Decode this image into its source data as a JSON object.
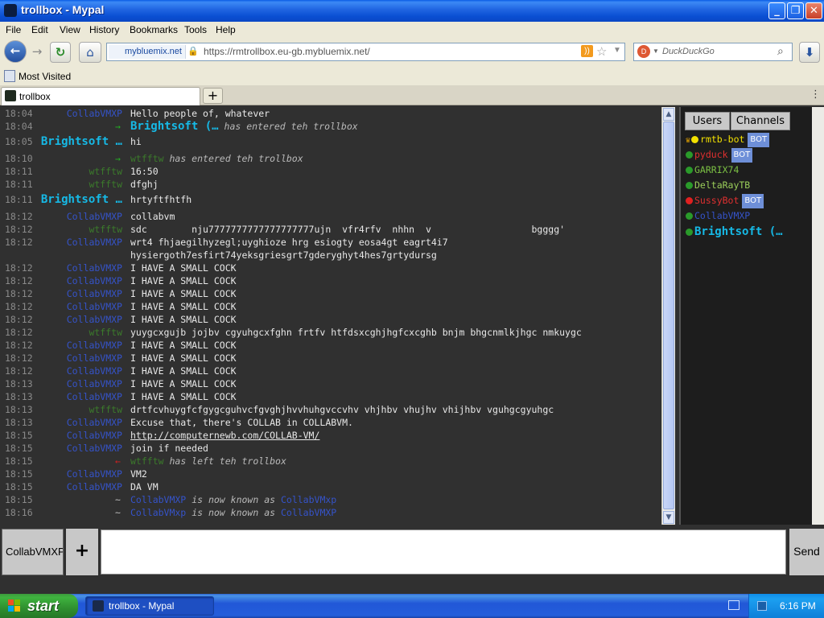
{
  "window": {
    "title": "trollbox - Mypal"
  },
  "menu": [
    "File",
    "Edit",
    "View",
    "History",
    "Bookmarks",
    "Tools",
    "Help"
  ],
  "navbar": {
    "identity": "mybluemix.net",
    "url": "https://rmtrollbox.eu-gb.mybluemix.net/",
    "search_placeholder": "DuckDuckGo"
  },
  "bookmarks": {
    "most_visited": "Most Visited"
  },
  "tabs": [
    {
      "label": "trollbox"
    }
  ],
  "chat": {
    "rows": [
      {
        "time": "18:04",
        "nick": "CollabVMXP",
        "nick_style": "blue",
        "msg": "Hello people of, whatever"
      },
      {
        "time": "18:04",
        "arrow": "→",
        "arrow_style": "green",
        "sys_nick": "Brightsoft (…",
        "sys_nick_style": "bright",
        "sys_text": "has entered teh trollbox"
      },
      {
        "time": "18:05",
        "nick": "Brightsoft …",
        "nick_style": "bright",
        "msg": "hi"
      },
      {
        "time": "18:10",
        "arrow": "→",
        "arrow_style": "green",
        "sys_nick": "wtfftw",
        "sys_nick_style": "green",
        "sys_text": "has entered teh trollbox"
      },
      {
        "time": "18:11",
        "nick": "wtfftw",
        "nick_style": "green",
        "msg": "16:50"
      },
      {
        "time": "18:11",
        "nick": "wtfftw",
        "nick_style": "green",
        "msg": "dfghj"
      },
      {
        "time": "18:11",
        "nick": "Brightsoft …",
        "nick_style": "bright",
        "msg": "hrtyftfhtfh"
      },
      {
        "time": "18:12",
        "nick": "CollabVMXP",
        "nick_style": "blue",
        "msg": "collabvm"
      },
      {
        "time": "18:12",
        "nick": "wtfftw",
        "nick_style": "green",
        "msg": "sdc        nju7777777777777777777ujn  vfr4rfv  nhhn  v                  bgggg'"
      },
      {
        "time": "18:12",
        "nick": "CollabVMXP",
        "nick_style": "blue",
        "msg": "wrt4 fhjaegilhyzegl;uyghioze hrg esiogty eosa4gt eagrt4i7"
      },
      {
        "time": "",
        "nick": "",
        "msg": "hysiergoth7esfirt74yeksgriesgrt7gderyghyt4hes7grtydursg"
      },
      {
        "time": "18:12",
        "nick": "CollabVMXP",
        "nick_style": "blue",
        "msg": "I HAVE A SMALL COCK"
      },
      {
        "time": "18:12",
        "nick": "CollabVMXP",
        "nick_style": "blue",
        "msg": "I HAVE A SMALL COCK"
      },
      {
        "time": "18:12",
        "nick": "CollabVMXP",
        "nick_style": "blue",
        "msg": "I HAVE A SMALL COCK"
      },
      {
        "time": "18:12",
        "nick": "CollabVMXP",
        "nick_style": "blue",
        "msg": "I HAVE A SMALL COCK"
      },
      {
        "time": "18:12",
        "nick": "CollabVMXP",
        "nick_style": "blue",
        "msg": "I HAVE A SMALL COCK"
      },
      {
        "time": "18:12",
        "nick": "wtfftw",
        "nick_style": "green",
        "msg": "yuygcxgujb jojbv cgyuhgcxfghn frtfv htfdsxcghjhgfcxcghb bnjm bhgcnmlkjhgc nmkuygc"
      },
      {
        "time": "18:12",
        "nick": "CollabVMXP",
        "nick_style": "blue",
        "msg": "I HAVE A SMALL COCK"
      },
      {
        "time": "18:12",
        "nick": "CollabVMXP",
        "nick_style": "blue",
        "msg": "I HAVE A SMALL COCK"
      },
      {
        "time": "18:12",
        "nick": "CollabVMXP",
        "nick_style": "blue",
        "msg": "I HAVE A SMALL COCK"
      },
      {
        "time": "18:13",
        "nick": "CollabVMXP",
        "nick_style": "blue",
        "msg": "I HAVE A SMALL COCK"
      },
      {
        "time": "18:13",
        "nick": "CollabVMXP",
        "nick_style": "blue",
        "msg": "I HAVE A SMALL COCK"
      },
      {
        "time": "18:13",
        "nick": "wtfftw",
        "nick_style": "green",
        "msg": "drtfcvhuygfcfgygcguhvcfgvghjhvvhuhgvccvhv vhjhbv vhujhv vhijhbv vguhgcgyuhgc"
      },
      {
        "time": "18:13",
        "nick": "CollabVMXP",
        "nick_style": "blue",
        "msg": "Excuse that, there's COLLAB in COLLABVM."
      },
      {
        "time": "18:15",
        "nick": "CollabVMXP",
        "nick_style": "blue",
        "msg": "http://computernewb.com/COLLAB-VM/",
        "link": true
      },
      {
        "time": "18:15",
        "nick": "CollabVMXP",
        "nick_style": "blue",
        "msg": "join if needed"
      },
      {
        "time": "18:15",
        "arrow": "←",
        "arrow_style": "red",
        "sys_nick": "wtfftw",
        "sys_nick_style": "green",
        "sys_text": "has left teh trollbox"
      },
      {
        "time": "18:15",
        "nick": "CollabVMXP",
        "nick_style": "blue",
        "msg": "VM2"
      },
      {
        "time": "18:15",
        "nick": "CollabVMXP",
        "nick_style": "blue",
        "msg": "DA VM"
      },
      {
        "time": "18:15",
        "arrow": "~",
        "arrow_style": "grey",
        "sys_nick": "CollabVMXP",
        "sys_nick_style": "blue",
        "sys_text": "is now known as",
        "sys_nick2": "CollabVMxp"
      },
      {
        "time": "18:16",
        "arrow": "~",
        "arrow_style": "grey",
        "sys_nick": "CollabVMxp",
        "sys_nick_style": "blue",
        "sys_text": "is now known as",
        "sys_nick2": "CollabVMXP"
      }
    ]
  },
  "panel": {
    "tabs": [
      "Users",
      "Channels"
    ],
    "users": [
      {
        "name": "rmtb-bot",
        "color": "#f2e000",
        "dot": "#f2e000",
        "crown": true,
        "badge": "BOT"
      },
      {
        "name": "pyduck",
        "color": "#e03030",
        "dot": "#2a9a2a",
        "badge": "BOT"
      },
      {
        "name": "GARRIX74",
        "color": "#7bc043",
        "dot": "#2a9a2a"
      },
      {
        "name": "DeltaRayTB",
        "color": "#9acd5a",
        "dot": "#2a9a2a"
      },
      {
        "name": "SussyBot",
        "color": "#e03030",
        "dot": "#e02020",
        "badge": "BOT"
      },
      {
        "name": "CollabVMXP",
        "color": "#3553c9",
        "dot": "#2a9a2a"
      },
      {
        "name": "Brightsoft (…",
        "color": "#16b9e6",
        "dot": "#2a9a2a",
        "bold": true
      }
    ]
  },
  "input": {
    "channel_tab": "CollabVMXP",
    "add": "+",
    "send": "Send"
  },
  "taskbar": {
    "start": "start",
    "task": "trollbox - Mypal",
    "clock": "6:16 PM"
  }
}
